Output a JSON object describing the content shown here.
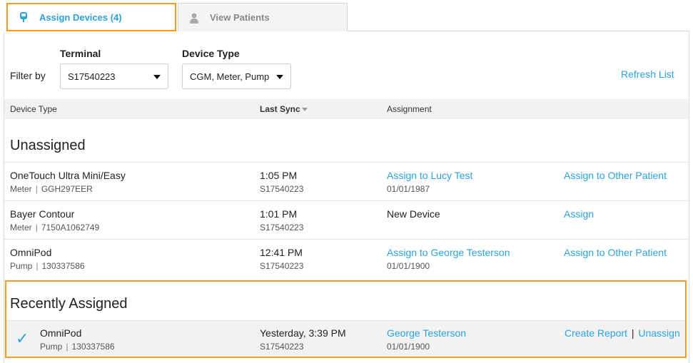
{
  "tabs": {
    "assign_label": "Assign Devices (4)",
    "patients_label": "View Patients"
  },
  "filter": {
    "label": "Filter by",
    "terminal_label": "Terminal",
    "terminal_value": "S17540223",
    "device_type_label": "Device Type",
    "device_type_value": "CGM, Meter, Pump",
    "refresh_label": "Refresh List"
  },
  "table": {
    "col_device_type": "Device Type",
    "col_last_sync": "Last Sync",
    "col_assignment": "Assignment"
  },
  "unassigned": {
    "title": "Unassigned",
    "rows": [
      {
        "name": "OneTouch Ultra Mini/Easy",
        "kind": "Meter",
        "serial": "GGH297EER",
        "time": "1:05 PM",
        "terminal": "S17540223",
        "assign": "Assign to Lucy Test",
        "dob": "01/01/1987",
        "action": "Assign to Other Patient"
      },
      {
        "name": "Bayer Contour",
        "kind": "Meter",
        "serial": "7150A1062749",
        "time": "1:01 PM",
        "terminal": "S17540223",
        "assign": "New Device",
        "dob": "",
        "action": "Assign"
      },
      {
        "name": "OmniPod",
        "kind": "Pump",
        "serial": "130337586",
        "time": "12:41 PM",
        "terminal": "S17540223",
        "assign": "Assign to George Testerson",
        "dob": "01/01/1900",
        "action": "Assign to Other Patient"
      }
    ]
  },
  "recent": {
    "title": "Recently Assigned",
    "row": {
      "name": "OmniPod",
      "kind": "Pump",
      "serial": "130337586",
      "time": "Yesterday, 3:39 PM",
      "terminal": "S17540223",
      "patient": "George Testerson",
      "dob": "01/01/1900",
      "create_report": "Create Report",
      "divider": "|",
      "unassign": "Unassign"
    }
  },
  "colors": {
    "accent": "#2aa3de",
    "highlight": "#f39c1f"
  }
}
